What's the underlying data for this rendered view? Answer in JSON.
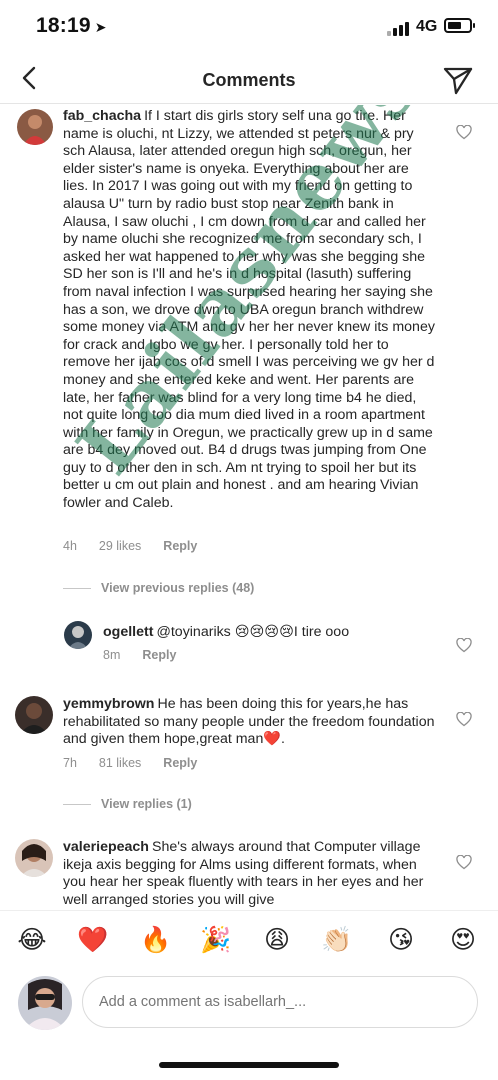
{
  "status_bar": {
    "time": "18:19",
    "location_glyph": "➤",
    "network": "4G"
  },
  "header": {
    "title": "Comments"
  },
  "comments": [
    {
      "username": "fab_chacha",
      "text": "If I start dis girls story self una go tire. Her name is oluchi, nt Lizzy, we attended st peters nur & pry sch Alausa, later attended oregun high sch, oregun, her elder sister's name is onyeka. Everything about her are lies. In 2017 I was going out with my friend on getting to alausa U\" turn by radio bust stop near Zenith bank in Alausa, I saw oluchi , I cm down from d car and called her by name oluchi she recognized me from secondary sch, I asked her wat happened to her why was she begging she SD her son is I'll and he's in d hospital (lasuth) suffering from naval infection I was surprised hearing her saying she has a son, we drove dwn to UBA oregun branch withdrew some money via ATM and gv her her never knew its money for crack and Igbo we gv her. I personally told her to remove her ijab cos of d smell I was perceiving  we gv her d money and she entered keke and went. Her parents are late, her father was blind for a very long time b4 he died, not quite long too dia mum died lived in a room apartment with her family in Oregun, we practically grew up in d same are b4 dey moved out. B4 d drugs twas jumping from One guy to d other den in sch. Am nt trying to spoil her but its better u cm out plain and honest . and am hearing Vivian fowler and Caleb.",
      "time": "4h",
      "likes": "29 likes",
      "reply_label": "Reply",
      "view_replies": "View previous replies (48)"
    },
    {
      "username": "ogellett",
      "text": "@toyinariks 😢😢😢😢I tire ooo",
      "time": "8m",
      "reply_label": "Reply"
    },
    {
      "username": "yemmybrown",
      "text": "He has been doing this for years,he has rehabilitated so many people under the freedom foundation and given them hope,great man❤️.",
      "time": "7h",
      "likes": "81 likes",
      "reply_label": "Reply",
      "view_replies": "View replies (1)"
    },
    {
      "username": "valeriepeach",
      "text": "She's always around that Computer village ikeja axis begging for Alms using different formats, when you hear her speak  fluently with tears in her eyes and her well arranged stories you will give"
    }
  ],
  "watermark": "Lailasnews",
  "emoji_bar": [
    "😂",
    "❤️",
    "🔥",
    "🎉",
    "😩",
    "👏🏻",
    "😘",
    "😍"
  ],
  "composer": {
    "placeholder": "Add a comment as isabellarh_..."
  },
  "colors": {
    "text": "#262626",
    "muted": "#8e8e8e",
    "heart_red": "#e0245e",
    "watermark": "#1f7850"
  },
  "icons": [
    "back-chevron-icon",
    "direct-send-icon",
    "heart-outline-icon",
    "location-arrow-icon",
    "signal-icon",
    "battery-icon"
  ]
}
